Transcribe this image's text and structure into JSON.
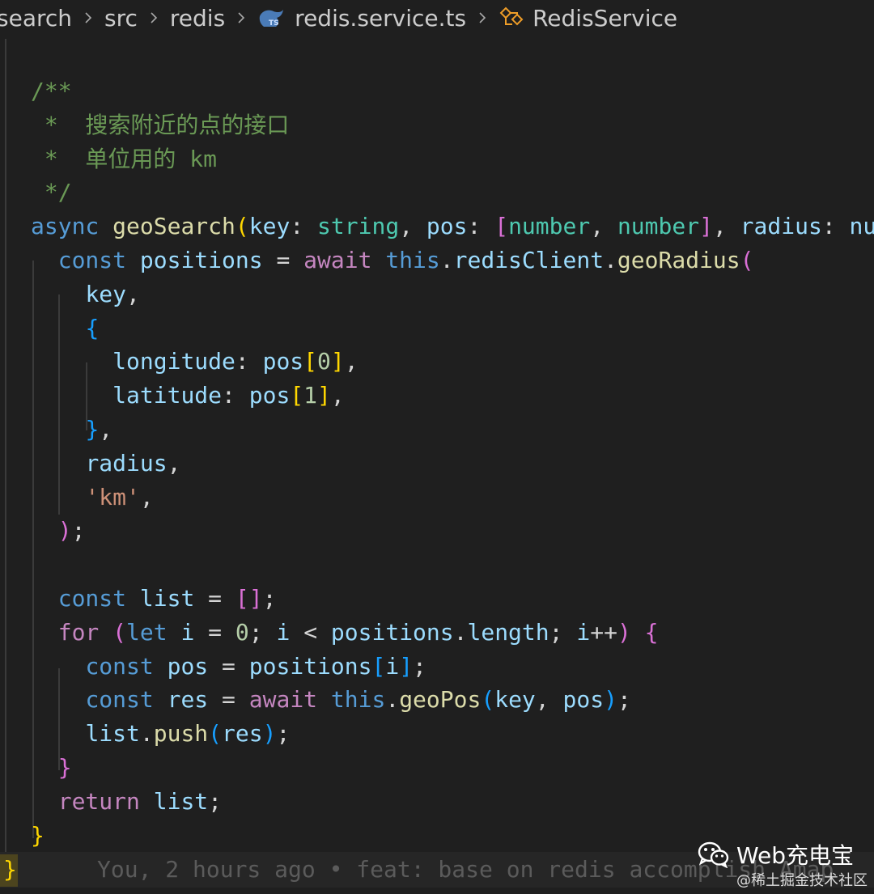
{
  "breadcrumb": {
    "items": [
      "search",
      "src",
      "redis",
      "redis.service.ts",
      "RedisService"
    ]
  },
  "code": {
    "lines": [
      "/**",
      " *  搜索附近的点的接口",
      " *  单位用的 km",
      " */",
      "async geoSearch(key: string, pos: [number, number], radius: nu",
      "  const positions = await this.redisClient.geoRadius(",
      "    key,",
      "    {",
      "      longitude: pos[0],",
      "      latitude: pos[1],",
      "    },",
      "    radius,",
      "    'km',",
      "  );",
      "",
      "  const list = [];",
      "  for (let i = 0; i < positions.length; i++) {",
      "    const pos = positions[i];",
      "    const res = await this.geoPos(key, pos);",
      "    list.push(res);",
      "  }",
      "  return list;",
      "}"
    ],
    "last_line_brace": "}",
    "blame": "You, 2 hours ago • feat: base on redis accomplish Amap"
  },
  "watermark": {
    "brand": "Web充电宝",
    "community": "@稀土掘金技术社区"
  },
  "colors": {
    "background": "#1f1f1f",
    "comment": "#6a9955",
    "keyword": "#569cd6",
    "function": "#dcdcaa",
    "parameter": "#9cdcfe",
    "type": "#4ec9b0",
    "string": "#ce9178",
    "number": "#b5cea8",
    "control": "#c586c0"
  }
}
